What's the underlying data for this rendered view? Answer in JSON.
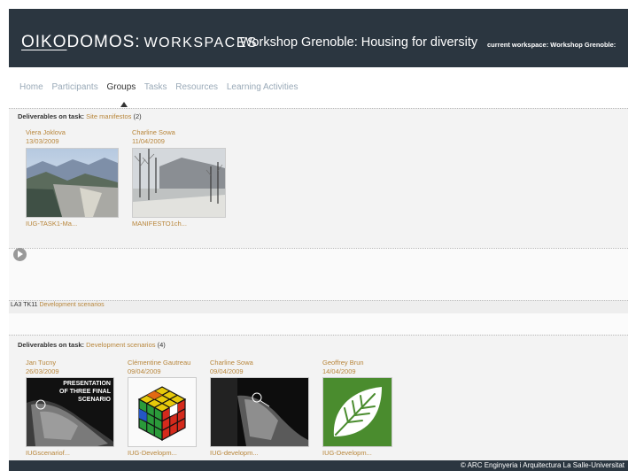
{
  "header": {
    "brand_part1": "OIKO",
    "brand_part2": "DOMOS:",
    "brand_part3": "WORKSPACES",
    "workshop_title": "Workshop Grenoble: Housing for diversity",
    "current_workspace": "current workspace: Workshop Grenoble:"
  },
  "nav": {
    "tabs": [
      {
        "label": "Home"
      },
      {
        "label": "Participants"
      },
      {
        "label": "Groups"
      },
      {
        "label": "Tasks"
      },
      {
        "label": "Resources"
      },
      {
        "label": "Learning Activities"
      }
    ],
    "active": "Groups"
  },
  "section1": {
    "label": "Deliverables on task:",
    "task": "Site manifestos",
    "count": "(2)",
    "items": [
      {
        "author": "Viera Joklova",
        "date": "13/03/2009",
        "file": "IUG-TASK1-Ma..."
      },
      {
        "author": "Charline Sowa",
        "date": "11/04/2009",
        "file": "MANIFESTO1ch..."
      }
    ]
  },
  "task_bar": {
    "code": "LA3 TK11",
    "task": "Development scenarios"
  },
  "section2": {
    "label": "Deliverables on task:",
    "task": "Development scenarios",
    "count": "(4)",
    "items": [
      {
        "author": "Jan Tucny",
        "date": "26/03/2009",
        "file": "IUGscenariof...",
        "thumb_text1": "PRESENTATION",
        "thumb_text2": "OF THREE FINAL SCENARIO"
      },
      {
        "author": "Clémentine Gautreau",
        "date": "09/04/2009",
        "file": "IUG-Developm..."
      },
      {
        "author": "Charline Sowa",
        "date": "09/04/2009",
        "file": "IUG-developm..."
      },
      {
        "author": "Geoffrey Brun",
        "date": "14/04/2009",
        "file": "IUG-Developm..."
      }
    ]
  },
  "footer": {
    "text": "© ARC Enginyeria i Arquitectura La Salle-Universitat"
  },
  "colors": {
    "header_bg": "#2b3640",
    "link": "#b8863b",
    "nav_inactive": "#9aaab8"
  }
}
